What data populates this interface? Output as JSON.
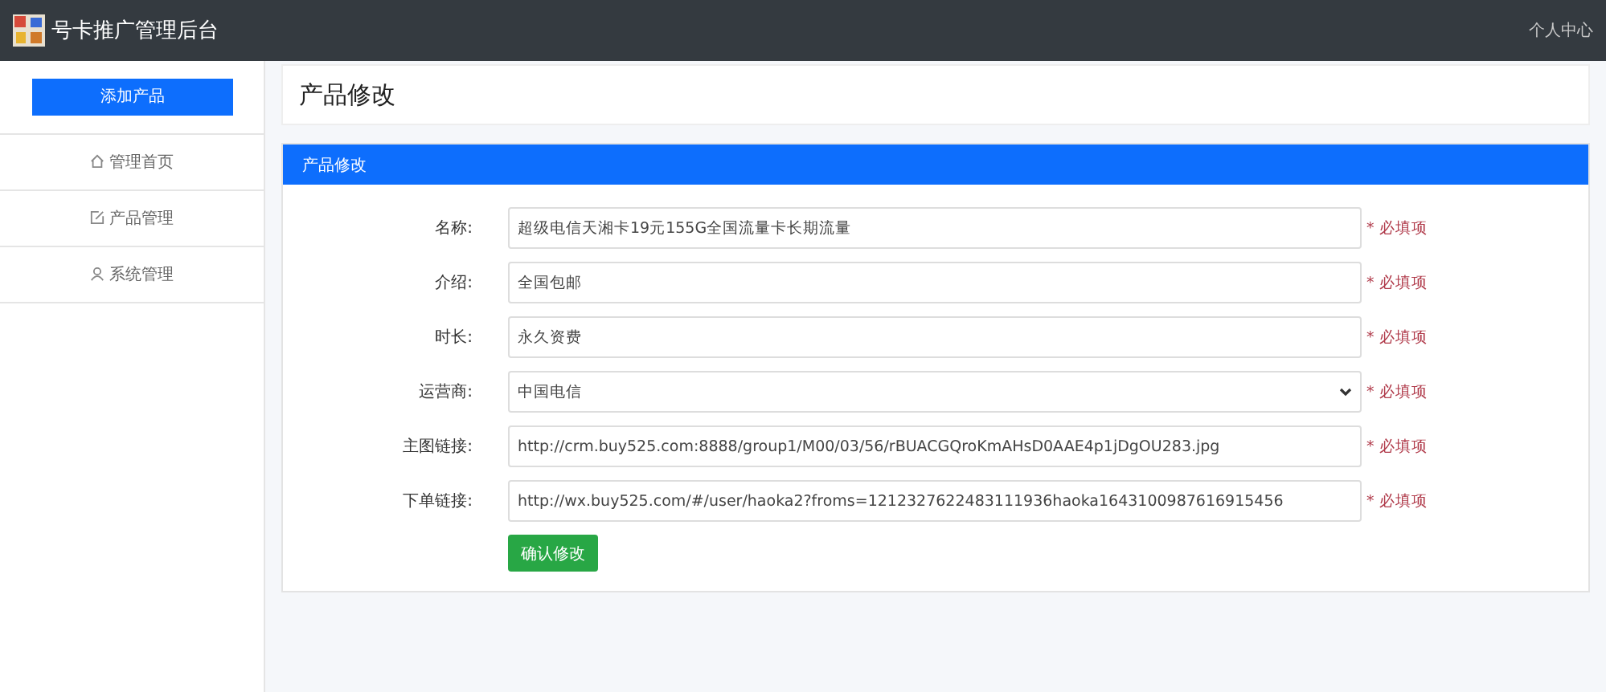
{
  "navbar": {
    "title": "号卡推广管理后台",
    "user_link": "个人中心"
  },
  "sidebar": {
    "add_button": "添加产品",
    "items": [
      {
        "label": "管理首页",
        "kind": "home"
      },
      {
        "label": "产品管理",
        "kind": "edit"
      },
      {
        "label": "系统管理",
        "kind": "user"
      }
    ]
  },
  "page_title": "产品修改",
  "panel": {
    "title": "产品修改",
    "fields": [
      {
        "label": "名称:",
        "kind": "text",
        "value": "超级电信天湘卡19元155G全国流量卡长期流量",
        "note": "* 必填项"
      },
      {
        "label": "介绍:",
        "kind": "text",
        "value": "全国包邮",
        "note": "* 必填项"
      },
      {
        "label": "时长:",
        "kind": "text",
        "value": "永久资费",
        "note": "* 必填项"
      },
      {
        "label": "运营商:",
        "kind": "select",
        "value": "中国电信",
        "note": "* 必填项"
      },
      {
        "label": "主图链接:",
        "kind": "text",
        "value": "http://crm.buy525.com:8888/group1/M00/03/56/rBUACGQroKmAHsD0AAE4p1jDgOU283.jpg",
        "note": "* 必填项"
      },
      {
        "label": "下单链接:",
        "kind": "text",
        "value": "http://wx.buy525.com/#/user/haoka2?froms=1212327622483111936haoka1643100987616915456",
        "note": "* 必填项"
      }
    ],
    "submit_button": "确认修改"
  }
}
